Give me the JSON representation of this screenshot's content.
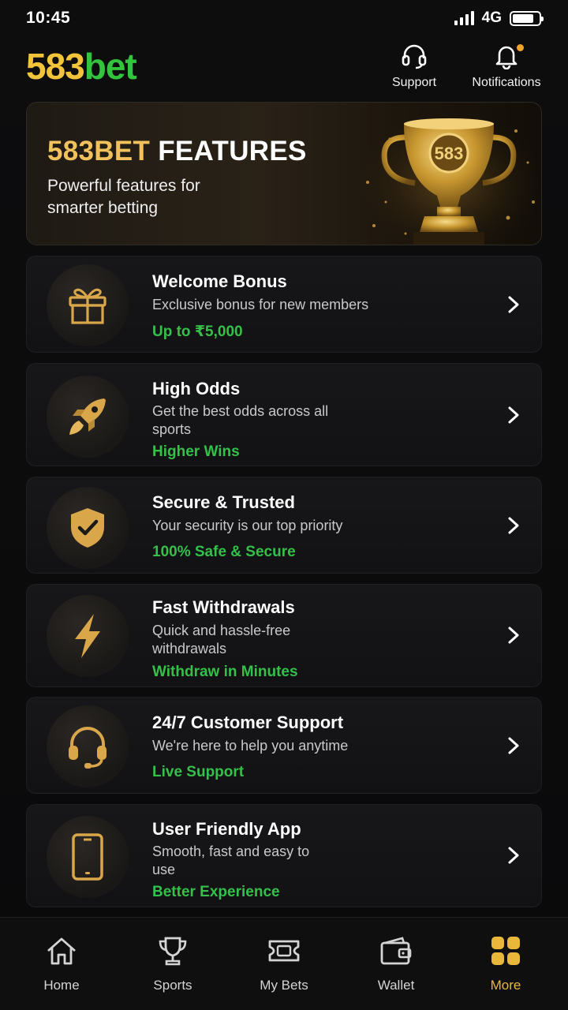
{
  "status_bar": {
    "time": "10:45",
    "network": "4G"
  },
  "header": {
    "logo_number": "583",
    "logo_word": "bet",
    "support_label": "Support",
    "notifications_label": "Notifications"
  },
  "banner": {
    "title_brand": "583BET",
    "title_rest": "FEATURES",
    "subtitle": "Powerful features for smarter betting",
    "trophy_text": "583"
  },
  "features": [
    {
      "title": "Welcome Bonus",
      "desc": "Exclusive bonus for new members",
      "tag": "Up to ₹5,000",
      "icon": "gift-icon"
    },
    {
      "title": "High Odds",
      "desc": "Get the best odds across all sports",
      "tag": "Higher Wins",
      "icon": "rocket-icon"
    },
    {
      "title": "Secure & Trusted",
      "desc": "Your security is our top priority",
      "tag": "100% Safe & Secure",
      "icon": "shield-check-icon"
    },
    {
      "title": "Fast Withdrawals",
      "desc": "Quick and hassle-free withdrawals",
      "tag": "Withdraw in Minutes",
      "icon": "lightning-icon"
    },
    {
      "title": "24/7 Customer Support",
      "desc": "We're here to help you anytime",
      "tag": "Live Support",
      "icon": "headset-icon"
    },
    {
      "title": "User Friendly App",
      "desc": "Smooth, fast and easy to use",
      "tag": "Better Experience",
      "icon": "phone-icon"
    }
  ],
  "nav": {
    "items": [
      {
        "label": "Home",
        "icon": "home-icon"
      },
      {
        "label": "Sports",
        "icon": "trophy-icon"
      },
      {
        "label": "My Bets",
        "icon": "ticket-icon"
      },
      {
        "label": "Wallet",
        "icon": "wallet-icon"
      },
      {
        "label": "More",
        "icon": "grid-icon"
      }
    ],
    "active": "More"
  },
  "colors": {
    "gold": "#f0c15c",
    "green": "#35c04a",
    "accent_nav": "#e9b83b",
    "background": "#0b0b0c"
  }
}
